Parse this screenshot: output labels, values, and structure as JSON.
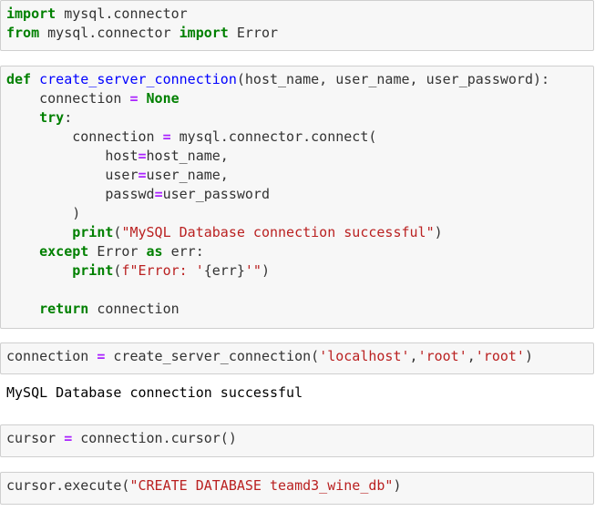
{
  "colors": {
    "keyword": "#008000",
    "function_name": "#0000ff",
    "string": "#ba2121",
    "operator": "#aa22ff",
    "text": "#333333",
    "cell_background": "#f7f7f7",
    "cell_border": "#cfcfcf"
  },
  "cells": [
    {
      "lines": [
        [
          {
            "c": "kw",
            "t": "import"
          },
          {
            "c": "",
            "t": " mysql.connector"
          }
        ],
        [
          {
            "c": "kw",
            "t": "from"
          },
          {
            "c": "",
            "t": " mysql.connector "
          },
          {
            "c": "kw",
            "t": "import"
          },
          {
            "c": "",
            "t": " Error"
          }
        ]
      ]
    },
    {
      "lines": [
        [
          {
            "c": "kw",
            "t": "def"
          },
          {
            "c": "",
            "t": " "
          },
          {
            "c": "fn",
            "t": "create_server_connection"
          },
          {
            "c": "",
            "t": "(host_name, user_name, user_password):"
          }
        ],
        [
          {
            "c": "",
            "t": "    connection "
          },
          {
            "c": "op",
            "t": "="
          },
          {
            "c": "",
            "t": " "
          },
          {
            "c": "kw",
            "t": "None"
          }
        ],
        [
          {
            "c": "",
            "t": "    "
          },
          {
            "c": "kw",
            "t": "try"
          },
          {
            "c": "",
            "t": ":"
          }
        ],
        [
          {
            "c": "",
            "t": "        connection "
          },
          {
            "c": "op",
            "t": "="
          },
          {
            "c": "",
            "t": " mysql.connector.connect("
          }
        ],
        [
          {
            "c": "",
            "t": "            host"
          },
          {
            "c": "op",
            "t": "="
          },
          {
            "c": "",
            "t": "host_name,"
          }
        ],
        [
          {
            "c": "",
            "t": "            user"
          },
          {
            "c": "op",
            "t": "="
          },
          {
            "c": "",
            "t": "user_name,"
          }
        ],
        [
          {
            "c": "",
            "t": "            passwd"
          },
          {
            "c": "op",
            "t": "="
          },
          {
            "c": "",
            "t": "user_password"
          }
        ],
        [
          {
            "c": "",
            "t": "        )"
          }
        ],
        [
          {
            "c": "",
            "t": "        "
          },
          {
            "c": "kw",
            "t": "print"
          },
          {
            "c": "",
            "t": "("
          },
          {
            "c": "st",
            "t": "\"MySQL Database connection successful\""
          },
          {
            "c": "",
            "t": ")"
          }
        ],
        [
          {
            "c": "",
            "t": "    "
          },
          {
            "c": "kw",
            "t": "except"
          },
          {
            "c": "",
            "t": " Error "
          },
          {
            "c": "kw",
            "t": "as"
          },
          {
            "c": "",
            "t": " err:"
          }
        ],
        [
          {
            "c": "",
            "t": "        "
          },
          {
            "c": "kw",
            "t": "print"
          },
          {
            "c": "",
            "t": "("
          },
          {
            "c": "st",
            "t": "f\"Error: '"
          },
          {
            "c": "",
            "t": "{err}"
          },
          {
            "c": "st",
            "t": "'\""
          },
          {
            "c": "",
            "t": ")"
          }
        ],
        [
          {
            "c": "",
            "t": ""
          }
        ],
        [
          {
            "c": "",
            "t": "    "
          },
          {
            "c": "kw",
            "t": "return"
          },
          {
            "c": "",
            "t": " connection"
          }
        ]
      ]
    },
    {
      "lines": [
        [
          {
            "c": "",
            "t": "connection "
          },
          {
            "c": "op",
            "t": "="
          },
          {
            "c": "",
            "t": " create_server_connection("
          },
          {
            "c": "st",
            "t": "'localhost'"
          },
          {
            "c": "",
            "t": ","
          },
          {
            "c": "st",
            "t": "'root'"
          },
          {
            "c": "",
            "t": ","
          },
          {
            "c": "st",
            "t": "'root'"
          },
          {
            "c": "",
            "t": ")"
          }
        ]
      ]
    },
    {
      "lines": [
        [
          {
            "c": "",
            "t": "cursor "
          },
          {
            "c": "op",
            "t": "="
          },
          {
            "c": "",
            "t": " connection.cursor()"
          }
        ]
      ]
    },
    {
      "lines": [
        [
          {
            "c": "",
            "t": "cursor.execute("
          },
          {
            "c": "st",
            "t": "\"CREATE DATABASE teamd3_wine_db\""
          },
          {
            "c": "",
            "t": ")"
          }
        ]
      ]
    }
  ],
  "output": {
    "text": "MySQL Database connection successful"
  }
}
